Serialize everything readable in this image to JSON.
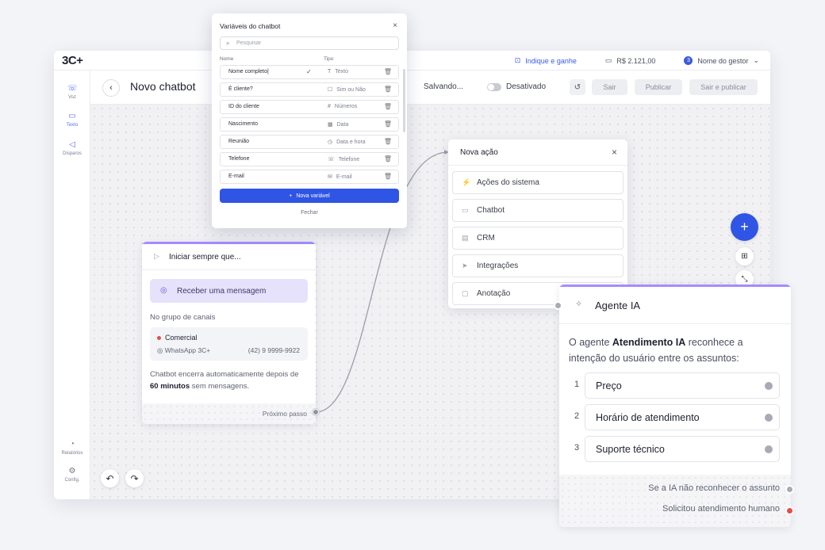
{
  "app": {
    "logo": "3C+",
    "indique": "Indique e ganhe",
    "balance": "R$ 2.121,00",
    "manager_badge": "3",
    "manager_name": "Nome do gestor"
  },
  "sidebar": {
    "items": [
      {
        "label": "Voz"
      },
      {
        "label": "Texto"
      },
      {
        "label": "Disparos"
      },
      {
        "label": "Relatórios"
      },
      {
        "label": "Config."
      }
    ]
  },
  "header": {
    "title": "Novo chatbot",
    "status": "Salvando...",
    "toggle_label": "Desativado",
    "btn_exit": "Sair",
    "btn_publish": "Publicar",
    "btn_exit_publish": "Sair e publicar"
  },
  "modal": {
    "title": "Variáveis do chatbot",
    "search_placeholder": "Pesquisar",
    "col_name": "Nome",
    "col_type": "Tipo",
    "rows": [
      {
        "name": "Nome completo|",
        "type": "Texto",
        "icon": "T"
      },
      {
        "name": "É cliente?",
        "type": "Sim ou Não",
        "icon": "☐"
      },
      {
        "name": "ID do cliente",
        "type": "Números",
        "icon": "#"
      },
      {
        "name": "Nascimento",
        "type": "Data",
        "icon": "▦"
      },
      {
        "name": "Reunião",
        "type": "Data e hora",
        "icon": "◷"
      },
      {
        "name": "Telefone",
        "type": "Telefone",
        "icon": "☏"
      },
      {
        "name": "E-mail",
        "type": "E-mail",
        "icon": "✉"
      }
    ],
    "new_button": "Nova variável",
    "close_link": "Fechar"
  },
  "trigger": {
    "title": "Iniciar sempre que...",
    "event": "Receber uma mensagem",
    "group_label": "No grupo de canais",
    "channel_name": "Comercial",
    "channel_type": "WhatsApp 3C+",
    "channel_phone": "(42) 9 9999-9922",
    "note_pre": "Chatbot encerra automaticamente depois de ",
    "note_bold": "60 minutos",
    "note_post": " sem mensagens.",
    "next_step": "Próximo passo"
  },
  "action_panel": {
    "title": "Nova ação",
    "items": [
      {
        "label": "Ações do sistema",
        "icon": "⚡"
      },
      {
        "label": "Chatbot",
        "icon": "▭"
      },
      {
        "label": "CRM",
        "icon": "▤"
      },
      {
        "label": "Integrações",
        "icon": "➤"
      },
      {
        "label": "Anotação",
        "icon": "▢"
      }
    ]
  },
  "agent": {
    "title": "Agente IA",
    "desc_pre": "O agente ",
    "desc_bold": "Atendimento IA",
    "desc_post": " reconhece a intenção do usuário entre os assuntos:",
    "options": [
      {
        "num": "1",
        "label": "Preço"
      },
      {
        "num": "2",
        "label": "Horário de atendimento"
      },
      {
        "num": "3",
        "label": "Suporte técnico"
      }
    ],
    "fallback": "Se a IA não reconhecer o assunto",
    "human": "Solicitou atendimento humano"
  },
  "colors": {
    "accent": "#2f55e4",
    "purple": "#a58bff",
    "danger": "#e94b4b"
  }
}
